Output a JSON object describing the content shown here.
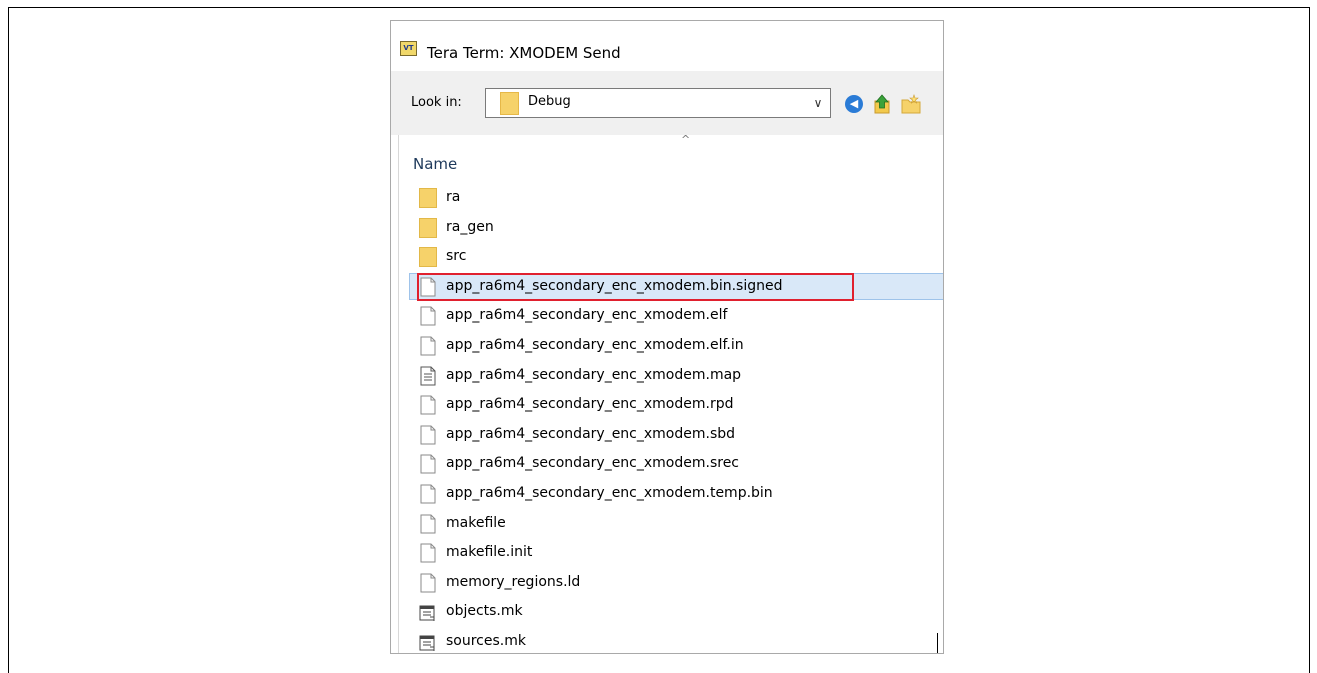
{
  "dialog": {
    "title": "Tera Term: XMODEM Send",
    "app_icon_text": "VT"
  },
  "toolbar": {
    "look_in_label": "Look in:",
    "look_in_value": "Debug"
  },
  "list": {
    "column_name": "Name",
    "sort_indicator": "^",
    "items": [
      {
        "label": "ra",
        "icon": "folder-icon"
      },
      {
        "label": "ra_gen",
        "icon": "folder-icon"
      },
      {
        "label": "src",
        "icon": "folder-icon"
      },
      {
        "label": "app_ra6m4_secondary_enc_xmodem.bin.signed",
        "icon": "file-icon",
        "selected": true
      },
      {
        "label": "app_ra6m4_secondary_enc_xmodem.elf",
        "icon": "file-icon"
      },
      {
        "label": "app_ra6m4_secondary_enc_xmodem.elf.in",
        "icon": "file-icon"
      },
      {
        "label": "app_ra6m4_secondary_enc_xmodem.map",
        "icon": "text-file-icon"
      },
      {
        "label": "app_ra6m4_secondary_enc_xmodem.rpd",
        "icon": "file-icon"
      },
      {
        "label": "app_ra6m4_secondary_enc_xmodem.sbd",
        "icon": "file-icon"
      },
      {
        "label": "app_ra6m4_secondary_enc_xmodem.srec",
        "icon": "file-icon"
      },
      {
        "label": "app_ra6m4_secondary_enc_xmodem.temp.bin",
        "icon": "file-icon"
      },
      {
        "label": "makefile",
        "icon": "file-icon"
      },
      {
        "label": "makefile.init",
        "icon": "file-icon"
      },
      {
        "label": "memory_regions.ld",
        "icon": "file-icon"
      },
      {
        "label": "objects.mk",
        "icon": "makefile-icon"
      },
      {
        "label": "sources.mk",
        "icon": "makefile-icon"
      }
    ]
  },
  "colors": {
    "highlight_border": "#e0202e",
    "selection_bg": "#d9e8f8",
    "folder": "#f6d26a"
  }
}
